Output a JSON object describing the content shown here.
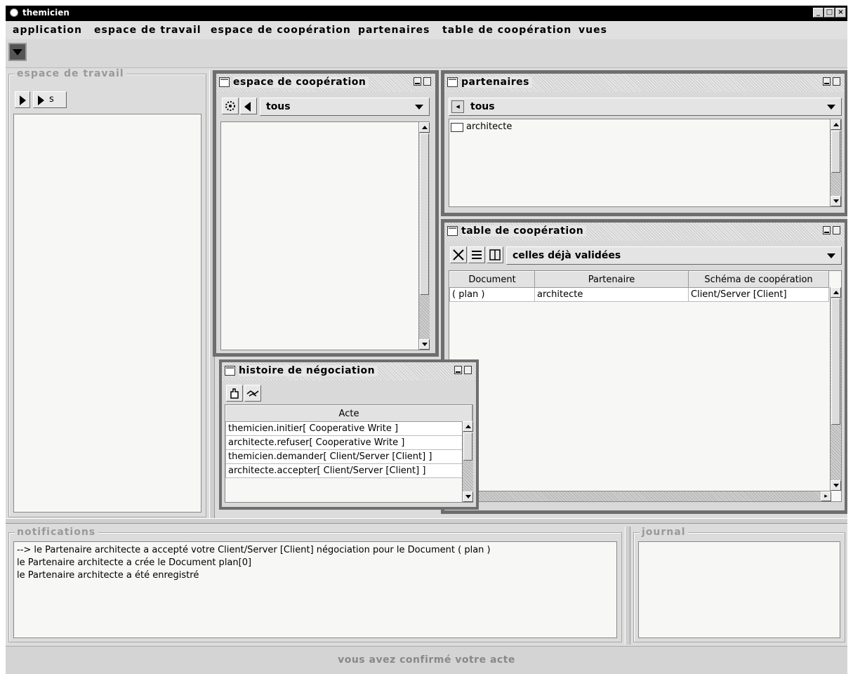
{
  "window": {
    "title": "themicien"
  },
  "menu": [
    "application",
    "espace de travail",
    "espace de coopération",
    "partenaires",
    "table de coopération",
    "vues"
  ],
  "workspace": {
    "label": "espace de travail",
    "button_s": "s"
  },
  "coop_space": {
    "title": "espace de coopération",
    "filter": "tous"
  },
  "partners": {
    "title": "partenaires",
    "filter": "tous",
    "items": [
      "architecte"
    ]
  },
  "coop_table": {
    "title": "table de coopération",
    "filter": "celles déjà validées",
    "columns": [
      "Document",
      "Partenaire",
      "Schéma de coopération"
    ],
    "rows": [
      [
        "( plan )",
        "architecte",
        "Client/Server [Client]"
      ]
    ]
  },
  "negotiation": {
    "title": "histoire de négociation",
    "column": "Acte",
    "rows": [
      "themicien.initier[ Cooperative Write ]",
      "architecte.refuser[ Cooperative Write ]",
      "themicien.demander[ Client/Server [Client] ]",
      "architecte.accepter[ Client/Server [Client] ]"
    ]
  },
  "notifications": {
    "label": "notifications",
    "lines": [
      "--> le Partenaire architecte a accepté votre Client/Server [Client] négociation pour le Document ( plan )",
      "le Partenaire architecte a crée le Document plan[0]",
      "le Partenaire architecte a été enregistré"
    ]
  },
  "journal": {
    "label": "journal"
  },
  "status": "vous avez confirmé votre acte"
}
